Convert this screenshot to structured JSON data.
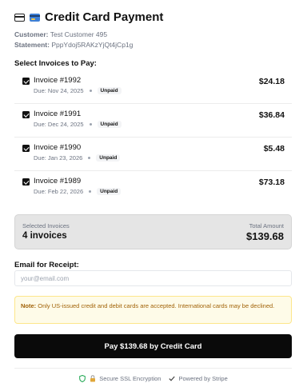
{
  "header": {
    "title": "Credit Card Payment",
    "customer_label": "Customer:",
    "customer_value": "Test Customer 495",
    "statement_label": "Statement:",
    "statement_value": "PppYdoj5RAKzYjQt4jCp1g"
  },
  "invoices_section": {
    "label": "Select Invoices to Pay:",
    "items": [
      {
        "title": "Invoice #1992",
        "due": "Due: Nov 24, 2025",
        "status": "Unpaid",
        "amount": "$24.18",
        "checked": true
      },
      {
        "title": "Invoice #1991",
        "due": "Due: Dec 24, 2025",
        "status": "Unpaid",
        "amount": "$36.84",
        "checked": true
      },
      {
        "title": "Invoice #1990",
        "due": "Due: Jan 23, 2026",
        "status": "Unpaid",
        "amount": "$5.48",
        "checked": true
      },
      {
        "title": "Invoice #1989",
        "due": "Due: Feb 22, 2026",
        "status": "Unpaid",
        "amount": "$73.18",
        "checked": true
      }
    ]
  },
  "summary": {
    "selected_label": "Selected Invoices",
    "selected_value": "4 invoices",
    "total_label": "Total Amount",
    "total_value": "$139.68"
  },
  "email": {
    "label": "Email for Receipt:",
    "placeholder": "your@email.com",
    "value": ""
  },
  "note": {
    "prefix": "Note:",
    "text": " Only US-issued credit and debit cards are accepted. International cards may be declined."
  },
  "pay_button": {
    "label": "Pay $139.68 by Credit Card"
  },
  "footer": {
    "ssl_text": "Secure SSL Encryption",
    "stripe_text": "Powered by Stripe"
  },
  "colors": {
    "accent": "#0a0a0a",
    "note_bg": "#fefbe8",
    "note_text": "#a16207",
    "shield": "#16a34a"
  }
}
